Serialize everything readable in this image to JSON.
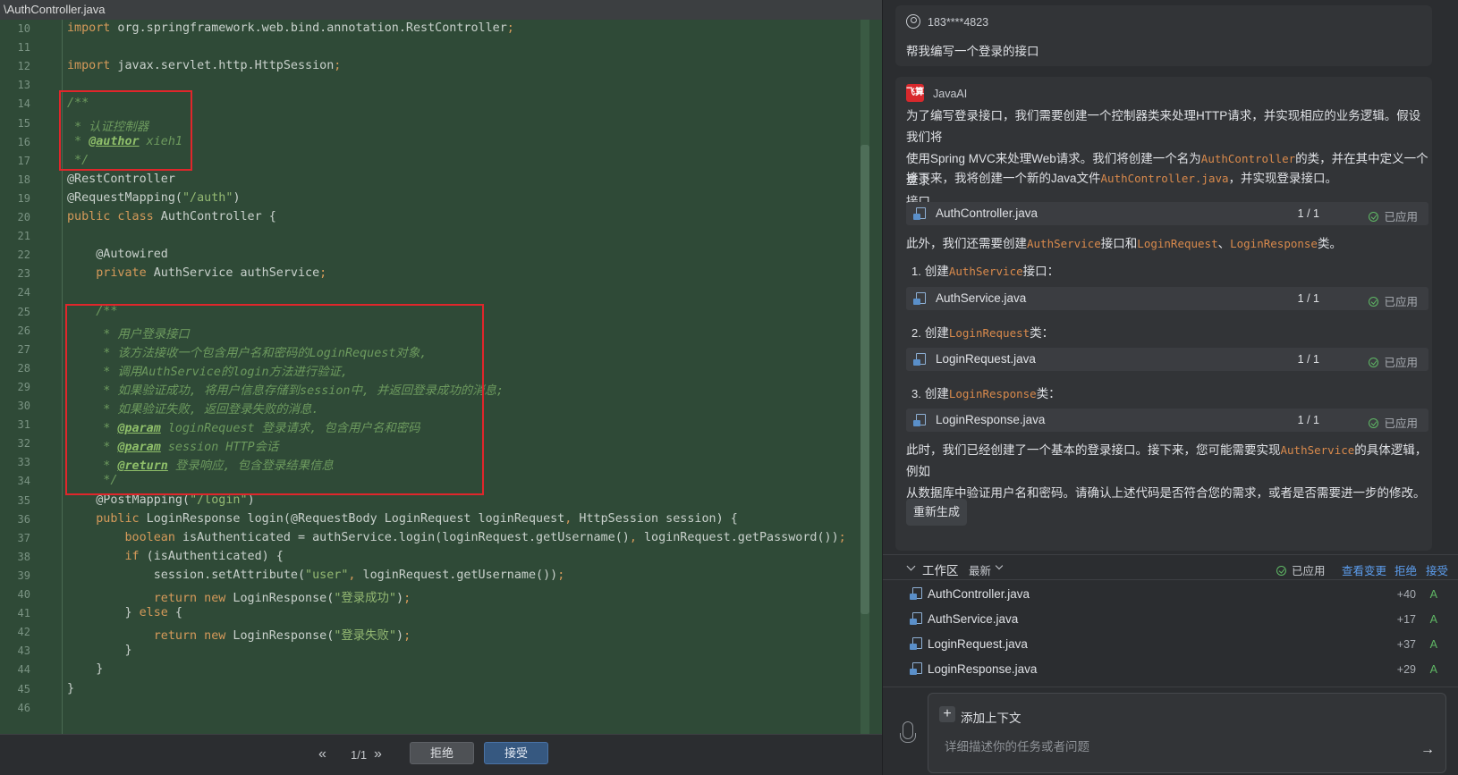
{
  "editor": {
    "tab_title": "\\AuthController.java",
    "pager": "1/1",
    "prev_icon": "«",
    "next_icon": "»",
    "reject_label": "拒绝",
    "accept_label": "接受",
    "lines": [
      {
        "n": "10",
        "html": "<span class='kw'>import</span> org.springframework.web.bind.annotation.RestController<span class='kw'>;</span>"
      },
      {
        "n": "11",
        "html": ""
      },
      {
        "n": "12",
        "html": "<span class='kw'>import</span> javax.servlet.http.HttpSession<span class='kw'>;</span>"
      },
      {
        "n": "13",
        "html": ""
      },
      {
        "n": "14",
        "html": "<span class='cm'>/**</span>"
      },
      {
        "n": "15",
        "html": "<span class='cm'> * 认证控制器</span>"
      },
      {
        "n": "16",
        "html": "<span class='cm'> * </span><span class='tag'>@author</span><span class='cm'> xieh1</span>"
      },
      {
        "n": "17",
        "html": "<span class='cm'> */</span>"
      },
      {
        "n": "18",
        "html": "@RestController"
      },
      {
        "n": "19",
        "html": "@RequestMapping(<span class='str'>\"/auth\"</span>)"
      },
      {
        "n": "20",
        "html": "<span class='kw'>public class</span> AuthController {"
      },
      {
        "n": "21",
        "html": ""
      },
      {
        "n": "22",
        "html": "    @Autowired"
      },
      {
        "n": "23",
        "html": "    <span class='kw'>private</span> AuthService authService<span class='kw'>;</span>"
      },
      {
        "n": "24",
        "html": ""
      },
      {
        "n": "25",
        "html": "    <span class='cm'>/**</span>"
      },
      {
        "n": "26",
        "html": "<span class='cm'>     * 用户登录接口</span>"
      },
      {
        "n": "27",
        "html": "<span class='cm'>     * 该方法接收一个包含用户名和密码的LoginRequest对象,</span>"
      },
      {
        "n": "28",
        "html": "<span class='cm'>     * 调用AuthService的login方法进行验证,</span>"
      },
      {
        "n": "29",
        "html": "<span class='cm'>     * 如果验证成功, 将用户信息存储到session中, 并返回登录成功的消息;</span>"
      },
      {
        "n": "30",
        "html": "<span class='cm'>     * 如果验证失败, 返回登录失败的消息.</span>"
      },
      {
        "n": "31",
        "html": "<span class='cm'>     * </span><span class='tag'>@param</span><span class='cm'> loginRequest 登录请求, 包含用户名和密码</span>"
      },
      {
        "n": "32",
        "html": "<span class='cm'>     * </span><span class='tag'>@param</span><span class='cm'> session HTTP会话</span>"
      },
      {
        "n": "33",
        "html": "<span class='cm'>     * </span><span class='tag'>@return</span><span class='cm'> 登录响应, 包含登录结果信息</span>"
      },
      {
        "n": "34",
        "html": "<span class='cm'>     */</span>"
      },
      {
        "n": "35",
        "html": "    @PostMapping(<span class='str'>\"/login\"</span>)"
      },
      {
        "n": "36",
        "html": "    <span class='kw'>public</span> LoginResponse login(@RequestBody LoginRequest loginRequest<span class='kw'>,</span> HttpSession session) {"
      },
      {
        "n": "37",
        "html": "        <span class='kw'>boolean</span> isAuthenticated = authService.login(loginRequest.getUsername()<span class='kw'>,</span> loginRequest.getPassword())<span class='kw'>;</span>"
      },
      {
        "n": "38",
        "html": "        <span class='kw'>if</span> (isAuthenticated) {"
      },
      {
        "n": "39",
        "html": "            session.setAttribute(<span class='str'>\"user\"</span><span class='kw'>,</span> loginRequest.getUsername())<span class='kw'>;</span>"
      },
      {
        "n": "40",
        "html": "            <span class='kw'>return new</span> LoginResponse(<span class='str'>\"登录成功\"</span>)<span class='kw'>;</span>"
      },
      {
        "n": "41",
        "html": "        } <span class='kw'>else</span> {"
      },
      {
        "n": "42",
        "html": "            <span class='kw'>return new</span> LoginResponse(<span class='str'>\"登录失败\"</span>)<span class='kw'>;</span>"
      },
      {
        "n": "43",
        "html": "        }"
      },
      {
        "n": "44",
        "html": "    }"
      },
      {
        "n": "45",
        "html": "}"
      },
      {
        "n": "46",
        "html": ""
      }
    ]
  },
  "chat": {
    "user": {
      "name": "183****4823",
      "message": "帮我编写一个登录的接口"
    },
    "ai": {
      "logo": "飞算",
      "name": "JavaAI",
      "p1a": "为了编写登录接口，我们需要创建一个控制器类来处理HTTP请求，并实现相应的业务逻辑。假设我们将",
      "p1b_pre": "使用Spring MVC来处理Web请求。我们将创建一个名为",
      "p1b_code": "AuthController",
      "p1b_post": "的类，并在其中定义一个登录",
      "p1c": "接口。",
      "p2_pre": "接下来，我将创建一个新的Java文件",
      "p2_code": "AuthController.java",
      "p2_post": "，并实现登录接口。",
      "p3_pre": "此外，我们还需要创建",
      "p3_code1": "AuthService",
      "p3_mid1": "接口和",
      "p3_code2": "LoginRequest",
      "p3_mid2": "、",
      "p3_code3": "LoginResponse",
      "p3_post": "类。",
      "steps": [
        {
          "num": "1.",
          "pre": "创建",
          "code": "AuthService",
          "post": "接口："
        },
        {
          "num": "2.",
          "pre": "创建",
          "code": "LoginRequest",
          "post": "类："
        },
        {
          "num": "3.",
          "pre": "创建",
          "code": "LoginResponse",
          "post": "类："
        }
      ],
      "files": [
        {
          "name": "AuthController.java",
          "count": "1 / 1",
          "status": "已应用"
        },
        {
          "name": "AuthService.java",
          "count": "1 / 1",
          "status": "已应用"
        },
        {
          "name": "LoginRequest.java",
          "count": "1 / 1",
          "status": "已应用"
        },
        {
          "name": "LoginResponse.java",
          "count": "1 / 1",
          "status": "已应用"
        }
      ],
      "p4a_pre": "此时，我们已经创建了一个基本的登录接口。接下来，您可能需要实现",
      "p4a_code": "AuthService",
      "p4a_post": "的具体逻辑，例如",
      "p4b": "从数据库中验证用户名和密码。请确认上述代码是否符合您的需求，或者是否需要进一步的修改。",
      "regenerate": "重新生成"
    },
    "workspace": {
      "title": "工作区",
      "sort": "最新",
      "applied": "已应用",
      "view_changes": "查看变更",
      "reject": "拒绝",
      "accept": "接受",
      "files": [
        {
          "name": "AuthController.java",
          "lines": "+40",
          "status": "A"
        },
        {
          "name": "AuthService.java",
          "lines": "+17",
          "status": "A"
        },
        {
          "name": "LoginRequest.java",
          "lines": "+37",
          "status": "A"
        },
        {
          "name": "LoginResponse.java",
          "lines": "+29",
          "status": "A"
        }
      ]
    },
    "input": {
      "add_context": "添加上下文",
      "add_icon": "+",
      "placeholder": "详细描述你的任务或者问题",
      "send_icon": "→"
    }
  },
  "colors": {
    "accent": "#365880",
    "applied_green": "#5fb865",
    "link_blue": "#5c9ded",
    "code_orange": "#d98a4c",
    "highlight_red": "#e0262b"
  }
}
